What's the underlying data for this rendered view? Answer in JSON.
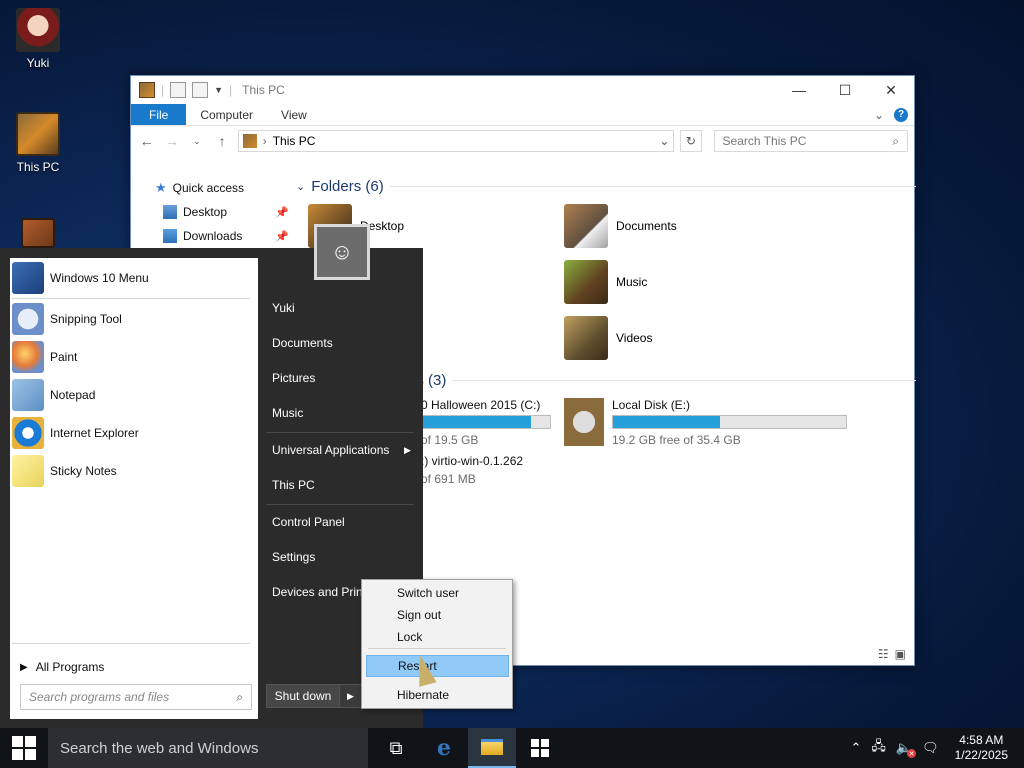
{
  "desktop": {
    "icons": [
      {
        "label": "Yuki",
        "icon": "user-avatar-icon"
      },
      {
        "label": "This PC",
        "icon": "this-pc-icon"
      },
      {
        "label": "",
        "icon": "box-icon"
      }
    ]
  },
  "explorer": {
    "title": "This PC",
    "ribbon_tabs": [
      "File",
      "Computer",
      "View"
    ],
    "address": "This PC",
    "search_placeholder": "Search This PC",
    "nav": {
      "quick_access": "Quick access",
      "items": [
        "Desktop",
        "Downloads"
      ]
    },
    "folders_header": "Folders (6)",
    "folders": [
      "Desktop",
      "Documents",
      "Music",
      "Videos"
    ],
    "drives_header": "es (3)",
    "drives": [
      {
        "name": "0 Halloween 2015 (C:)",
        "free": "of 19.5 GB",
        "fill": 0.85
      },
      {
        "name": "Local Disk (E:)",
        "free": "19.2 GB free of 35.4 GB",
        "fill": 0.46
      },
      {
        "name": ":) virtio-win-0.1.262",
        "free": "of 691 MB"
      }
    ]
  },
  "start_menu": {
    "pinned": [
      "Windows 10 Menu",
      "Snipping Tool",
      "Paint",
      "Notepad",
      "Internet Explorer",
      "Sticky Notes"
    ],
    "all_programs": "All Programs",
    "search_placeholder": "Search programs and files",
    "right_items": [
      "Yuki",
      "Documents",
      "Pictures",
      "Music",
      "Universal Applications",
      "This PC",
      "Control Panel",
      "Settings",
      "Devices and Print"
    ],
    "shutdown_label": "Shut down",
    "power_menu": [
      "Switch user",
      "Sign out",
      "Lock",
      "Restart",
      "Hibernate"
    ]
  },
  "taskbar": {
    "search_text": "Search the web and Windows",
    "time": "4:58 AM",
    "date": "1/22/2025"
  }
}
